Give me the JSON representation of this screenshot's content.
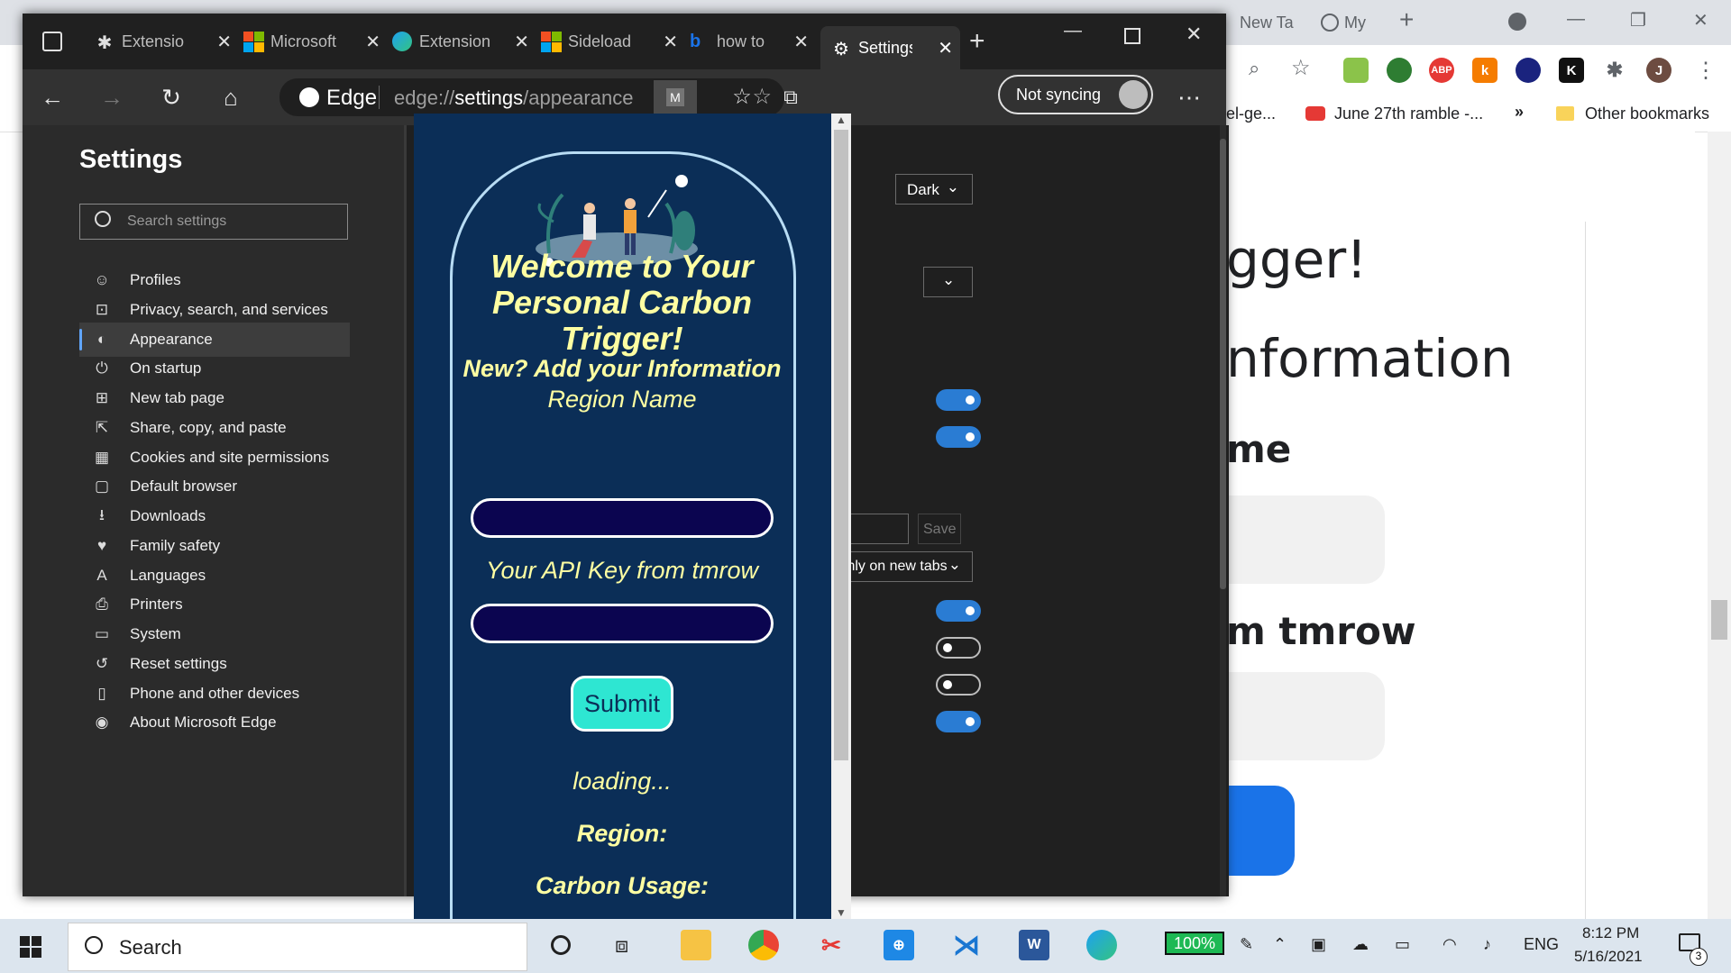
{
  "chrome": {
    "tabs": [
      "New Ta",
      "My"
    ],
    "bookmarks": [
      {
        "label": "el-ge..."
      },
      {
        "label": "June 27th ramble -..."
      },
      {
        "label": "»"
      },
      {
        "label": "Other bookmarks"
      }
    ],
    "page_text": {
      "line1": "gger!",
      "line2": "nformation",
      "line3": "me",
      "line4": "m tmrow"
    },
    "extension_icons": [
      "ABP",
      "k",
      "K",
      "J"
    ]
  },
  "edge": {
    "tabs": [
      {
        "label": "Extensio",
        "icon": "puzzle-icon"
      },
      {
        "label": "Microsoft",
        "icon": "microsoft-logo-icon"
      },
      {
        "label": "Extension",
        "icon": "edge-logo-icon"
      },
      {
        "label": "Sideload",
        "icon": "microsoft-logo-icon"
      },
      {
        "label": "how to",
        "icon": "bing-icon"
      },
      {
        "label": "Settings",
        "icon": "gear-icon"
      }
    ],
    "address": {
      "brand": "Edge",
      "url_prefix": "edge://",
      "url_host": "settings",
      "url_path": "/appearance"
    },
    "profile_badge": "M",
    "sync_label": "Not syncing",
    "sidebar": {
      "title": "Settings",
      "search_placeholder": "Search settings",
      "items": [
        {
          "label": "Profiles",
          "icon": "profile-icon"
        },
        {
          "label": "Privacy, search, and services",
          "icon": "lock-icon"
        },
        {
          "label": "Appearance",
          "icon": "appearance-icon",
          "active": true
        },
        {
          "label": "On startup",
          "icon": "power-icon"
        },
        {
          "label": "New tab page",
          "icon": "new-tab-icon"
        },
        {
          "label": "Share, copy, and paste",
          "icon": "share-icon"
        },
        {
          "label": "Cookies and site permissions",
          "icon": "cookies-icon"
        },
        {
          "label": "Default browser",
          "icon": "browser-icon"
        },
        {
          "label": "Downloads",
          "icon": "download-icon"
        },
        {
          "label": "Family safety",
          "icon": "family-icon"
        },
        {
          "label": "Languages",
          "icon": "language-icon"
        },
        {
          "label": "Printers",
          "icon": "printer-icon"
        },
        {
          "label": "System",
          "icon": "system-icon"
        },
        {
          "label": "Reset settings",
          "icon": "reset-icon"
        },
        {
          "label": "Phone and other devices",
          "icon": "phone-icon"
        },
        {
          "label": "About Microsoft Edge",
          "icon": "edge-logo-icon"
        }
      ]
    },
    "content": {
      "theme_dropdown": "Dark",
      "save_label": "Save",
      "show_home_dropdown": "Only on new tabs",
      "toggles": [
        true,
        true,
        true,
        false,
        false,
        true
      ]
    }
  },
  "popup": {
    "title": "Welcome to Your Personal Carbon Trigger!",
    "subtitle": "New? Add your Information",
    "region_label": "Region Name",
    "api_label": "Your API Key from tmrow",
    "submit_label": "Submit",
    "loading_text": "loading...",
    "region_result_label": "Region:",
    "carbon_result_label": "Carbon Usage:"
  },
  "taskbar": {
    "search_placeholder": "Search",
    "zoom": "100%",
    "language": "ENG",
    "time": "8:12 PM",
    "date": "5/16/2021",
    "notification_count": "3"
  },
  "colors": {
    "popup_bg": "#0b2e57",
    "popup_text": "#fefea2",
    "submit_bg": "#2ee6d2",
    "toggle_on": "#2a7cd3"
  }
}
